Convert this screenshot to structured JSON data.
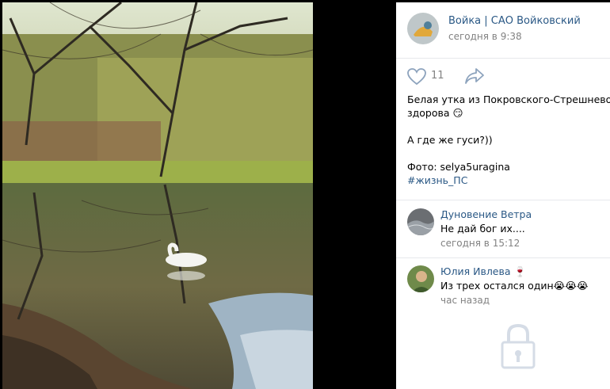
{
  "post": {
    "author": "Войка | САО Войковский",
    "time": "сегодня в 9:38",
    "likes": "11",
    "text_line1": "Белая утка из Покровского-Стрешнево жи",
    "text_line2": "здорова 😏",
    "text_line3": "А где же гуси?))",
    "text_line4": "Фото: selya5uragina",
    "hashtag": "#жизнь_ПС"
  },
  "comments": [
    {
      "author": "Дуновение Ветра",
      "text": "Не дай бог их....",
      "time": "сегодня в 15:12"
    },
    {
      "author": "Юлия Ивлева 🍷",
      "text": "Из трех остался один😭😭😭",
      "time": "час назад"
    }
  ],
  "icons": {
    "like": "heart-icon",
    "share": "share-icon",
    "lock": "lock-icon"
  },
  "colors": {
    "link": "#2a5885",
    "muted": "#828282",
    "accent_icon": "#8da3bd"
  }
}
